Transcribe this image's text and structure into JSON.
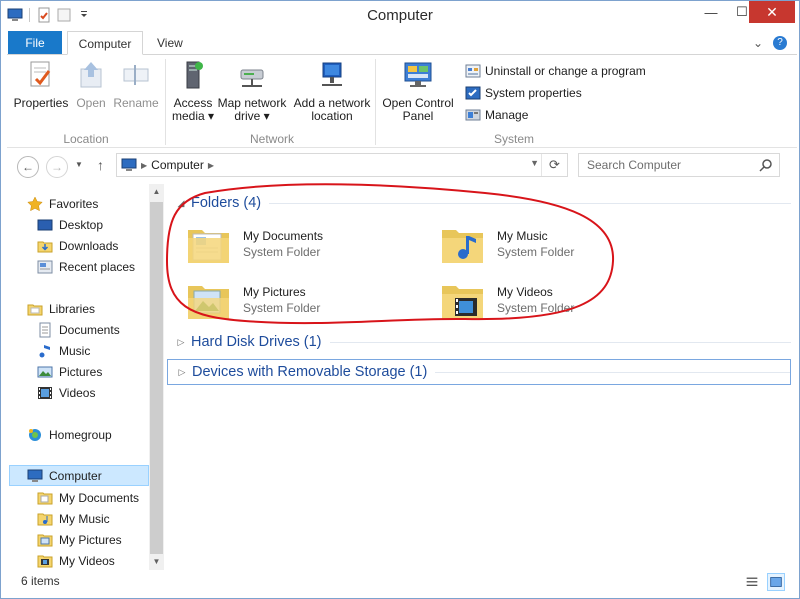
{
  "window": {
    "title": "Computer"
  },
  "ribbon_tabs": {
    "file": "File",
    "computer": "Computer",
    "view": "View"
  },
  "ribbon": {
    "location": {
      "label": "Location",
      "properties": "Properties",
      "open": "Open",
      "rename": "Rename"
    },
    "network": {
      "label": "Network",
      "access_media_line1": "Access",
      "access_media_line2": "media ▾",
      "map_drive_line1": "Map network",
      "map_drive_line2": "drive ▾",
      "add_location_line1": "Add a network",
      "add_location_line2": "location"
    },
    "system": {
      "label": "System",
      "control_panel_line1": "Open Control",
      "control_panel_line2": "Panel",
      "uninstall": "Uninstall or change a program",
      "system_properties": "System properties",
      "manage": "Manage"
    }
  },
  "address": {
    "path": "Computer",
    "search_placeholder": "Search Computer"
  },
  "nav": {
    "favorites": "Favorites",
    "desktop": "Desktop",
    "downloads": "Downloads",
    "recent_places": "Recent places",
    "libraries": "Libraries",
    "documents": "Documents",
    "music": "Music",
    "pictures": "Pictures",
    "videos": "Videos",
    "homegroup": "Homegroup",
    "computer": "Computer",
    "my_documents": "My Documents",
    "my_music": "My Music",
    "my_pictures": "My Pictures",
    "my_videos": "My Videos"
  },
  "content": {
    "groups": {
      "folders": "Folders (4)",
      "hard_disk": "Hard Disk Drives (1)",
      "removable": "Devices with Removable Storage (1)"
    },
    "folders": [
      {
        "name": "My Documents",
        "type": "System Folder"
      },
      {
        "name": "My Music",
        "type": "System Folder"
      },
      {
        "name": "My Pictures",
        "type": "System Folder"
      },
      {
        "name": "My Videos",
        "type": "System Folder"
      }
    ]
  },
  "status": {
    "item_count": "6 items"
  },
  "colors": {
    "accent": "#1979ca",
    "annotation": "#d8141a",
    "selection": "#cce8ff"
  }
}
